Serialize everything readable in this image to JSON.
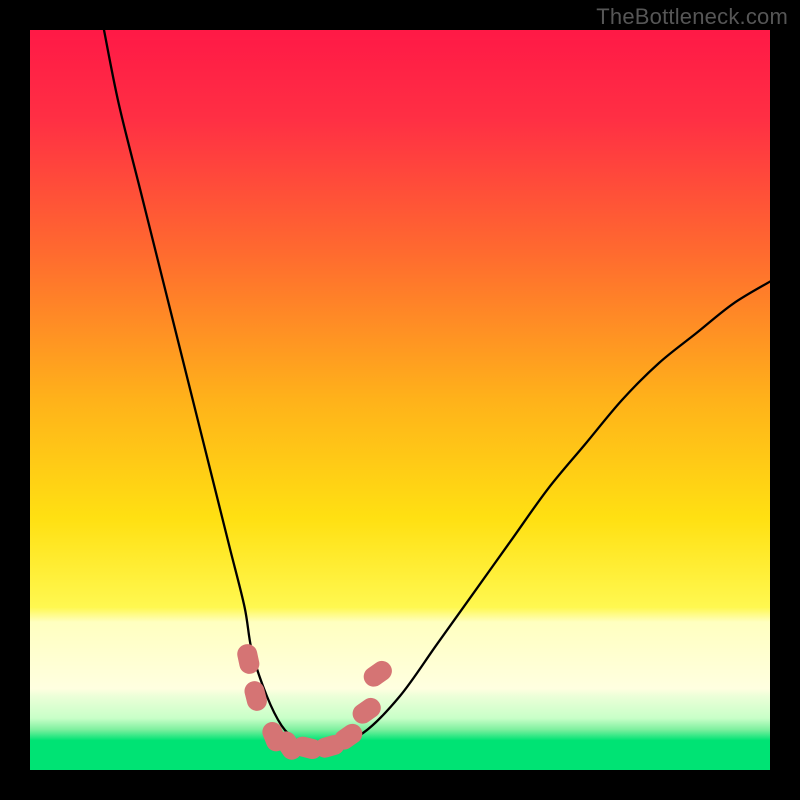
{
  "watermark": "TheBottleneck.com",
  "colors": {
    "top": "#ff1946",
    "mid": "#ffd700",
    "lightYellow": "#ffffc0",
    "paleGreen": "#dcffc8",
    "green": "#00e374",
    "line": "#000000",
    "marker": "#d57474",
    "frame": "#000000"
  },
  "chart_data": {
    "type": "line",
    "title": "",
    "xlabel": "",
    "ylabel": "",
    "xlim": [
      0,
      100
    ],
    "ylim": [
      0,
      100
    ],
    "grid": false,
    "series": [
      {
        "name": "bottleneck-curve",
        "x": [
          10,
          12,
          15,
          18,
          20,
          23,
          25,
          27,
          29,
          30,
          32,
          34,
          36,
          38,
          40,
          45,
          50,
          55,
          60,
          65,
          70,
          75,
          80,
          85,
          90,
          95,
          100
        ],
        "y": [
          100,
          90,
          78,
          66,
          58,
          46,
          38,
          30,
          22,
          16,
          10,
          6,
          4,
          3,
          3,
          5,
          10,
          17,
          24,
          31,
          38,
          44,
          50,
          55,
          59,
          63,
          66
        ]
      }
    ],
    "markers": [
      {
        "name": "left-upper",
        "x": 29.5,
        "y": 15
      },
      {
        "name": "left-lower",
        "x": 30.5,
        "y": 10
      },
      {
        "name": "valley-1",
        "x": 33,
        "y": 4.5
      },
      {
        "name": "valley-2",
        "x": 35,
        "y": 3.3
      },
      {
        "name": "valley-3",
        "x": 37.5,
        "y": 3
      },
      {
        "name": "valley-4",
        "x": 40.5,
        "y": 3.2
      },
      {
        "name": "valley-5",
        "x": 43,
        "y": 4.5
      },
      {
        "name": "right-lower",
        "x": 45.5,
        "y": 8
      },
      {
        "name": "right-upper",
        "x": 47,
        "y": 13
      }
    ],
    "gradient_bands": [
      {
        "name": "red-orange-yellow",
        "from": 100,
        "to": 20
      },
      {
        "name": "light-yellow",
        "from": 20,
        "to": 9
      },
      {
        "name": "pale-green",
        "from": 9,
        "to": 5
      },
      {
        "name": "green",
        "from": 5,
        "to": 0
      }
    ]
  }
}
